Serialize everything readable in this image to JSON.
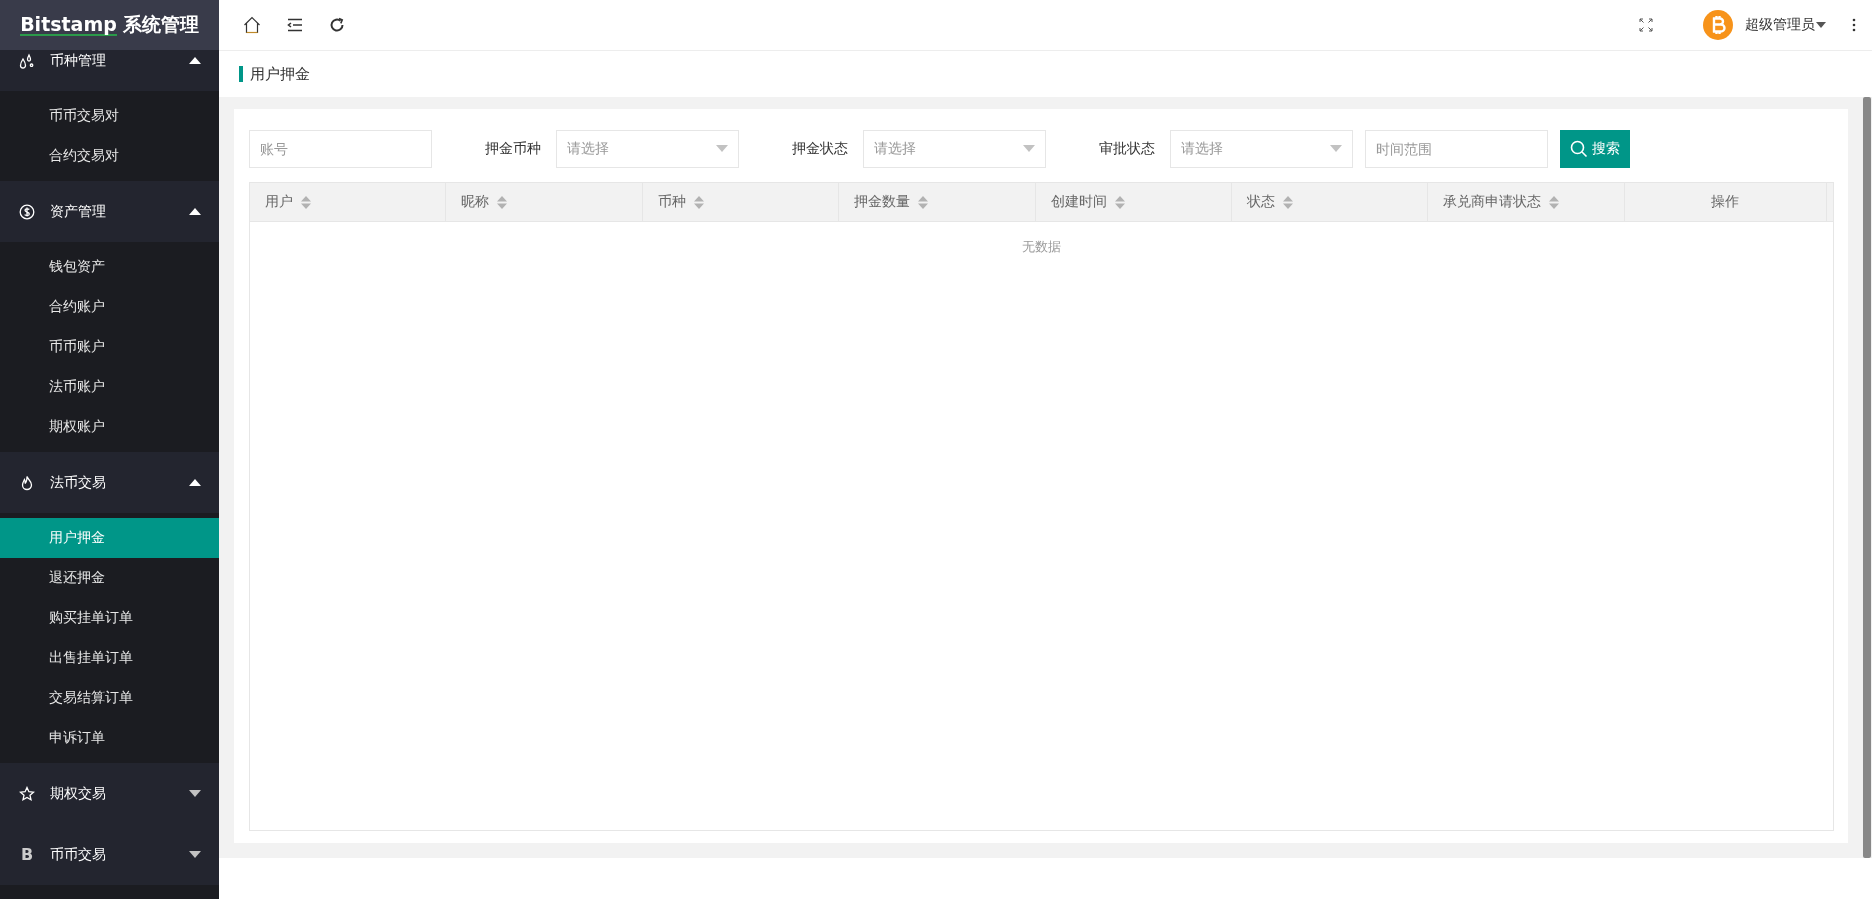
{
  "logo": {
    "brand": "Bitstamp",
    "title": "系统管理"
  },
  "sidebar": {
    "groups": [
      {
        "label": "币种管理",
        "kind": "drops",
        "expanded": true,
        "children": [
          {
            "label": "币币交易对",
            "selected": false
          },
          {
            "label": "合约交易对",
            "selected": false
          }
        ]
      },
      {
        "label": "资产管理",
        "kind": "dollar",
        "expanded": true,
        "children": [
          {
            "label": "钱包资产",
            "selected": false
          },
          {
            "label": "合约账户",
            "selected": false
          },
          {
            "label": "币币账户",
            "selected": false
          },
          {
            "label": "法币账户",
            "selected": false
          },
          {
            "label": "期权账户",
            "selected": false
          }
        ]
      },
      {
        "label": "法币交易",
        "kind": "flame",
        "expanded": true,
        "children": [
          {
            "label": "用户押金",
            "selected": true
          },
          {
            "label": "退还押金",
            "selected": false
          },
          {
            "label": "购买挂单订单",
            "selected": false
          },
          {
            "label": "出售挂单订单",
            "selected": false
          },
          {
            "label": "交易结算订单",
            "selected": false
          },
          {
            "label": "申诉订单",
            "selected": false
          }
        ]
      },
      {
        "label": "期权交易",
        "kind": "star",
        "expanded": false
      },
      {
        "label": "币币交易",
        "kind": "letter",
        "glyph": "B",
        "expanded": false
      }
    ]
  },
  "topbar": {
    "user": "超级管理员"
  },
  "breadcrumb": "用户押金",
  "filters": [
    {
      "kind": "input",
      "placeholder": "账号"
    },
    {
      "kind": "select",
      "label": "押金币种",
      "placeholder": "请选择"
    },
    {
      "kind": "select",
      "label": "押金状态",
      "placeholder": "请选择"
    },
    {
      "kind": "select",
      "label": "审批状态",
      "placeholder": "请选择"
    },
    {
      "kind": "input",
      "placeholder": "时间范围"
    }
  ],
  "search_button": "搜索",
  "table": {
    "columns": [
      {
        "label": "用户",
        "sortable": true
      },
      {
        "label": "昵称",
        "sortable": true
      },
      {
        "label": "币种",
        "sortable": true
      },
      {
        "label": "押金数量",
        "sortable": true
      },
      {
        "label": "创建时间",
        "sortable": true
      },
      {
        "label": "状态",
        "sortable": true
      },
      {
        "label": "承兑商申请状态",
        "sortable": true
      },
      {
        "label": "操作",
        "sortable": false
      }
    ],
    "empty_text": "无数据"
  }
}
